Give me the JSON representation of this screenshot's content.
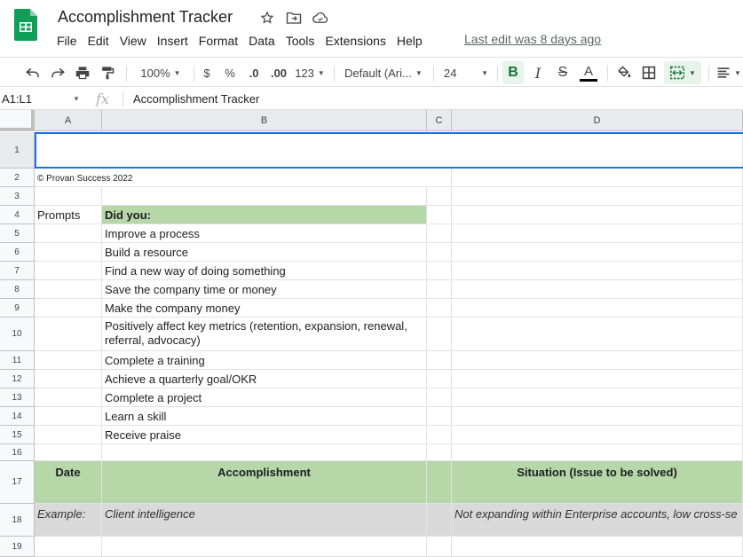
{
  "app": {
    "title": "Accomplishment Tracker",
    "last_edit": "Last edit was 8 days ago",
    "menu": [
      "File",
      "Edit",
      "View",
      "Insert",
      "Format",
      "Data",
      "Tools",
      "Extensions",
      "Help"
    ]
  },
  "toolbar": {
    "zoom": "100%",
    "currency": "$",
    "percent": "%",
    "dec_decrease": ".0",
    "dec_increase": ".00",
    "more_formats": "123",
    "font": "Default (Ari...",
    "font_size": "24",
    "bold": "B",
    "italic": "I",
    "strike": "S",
    "text_color": "A"
  },
  "formula_bar": {
    "name_box": "A1:L1",
    "fx": "fx",
    "value": "Accomplishment Tracker"
  },
  "columns": [
    "A",
    "B",
    "C",
    "D"
  ],
  "rows": [
    "1",
    "2",
    "3",
    "4",
    "5",
    "6",
    "7",
    "8",
    "9",
    "10",
    "11",
    "12",
    "13",
    "14",
    "15",
    "16",
    "17",
    "18",
    "19"
  ],
  "cells": {
    "copyright": "© Provan Success 2022",
    "prompts": "Prompts",
    "did_you": "Did you:",
    "items": [
      "Improve a process",
      "Build a resource",
      "Find a new way of doing something",
      "Save the company time or money",
      "Make the company money",
      "Positively affect key metrics (retention, expansion, renewal, referral, advocacy)",
      "Complete a training",
      "Achieve a quarterly goal/OKR",
      "Complete a project",
      "Learn a skill",
      "Receive praise"
    ],
    "header_date": "Date",
    "header_accomplishment": "Accomplishment",
    "header_situation": "Situation (Issue to be solved)",
    "example_label": "Example:",
    "example_accomplishment": "Client intelligence",
    "example_situation": "Not expanding within Enterprise accounts, low cross-se"
  },
  "colors": {
    "green_fill": "#b6d7a8",
    "grey_fill": "#d9d9d9",
    "selection": "#1a73e8",
    "sheets_green": "#0f9d58"
  }
}
